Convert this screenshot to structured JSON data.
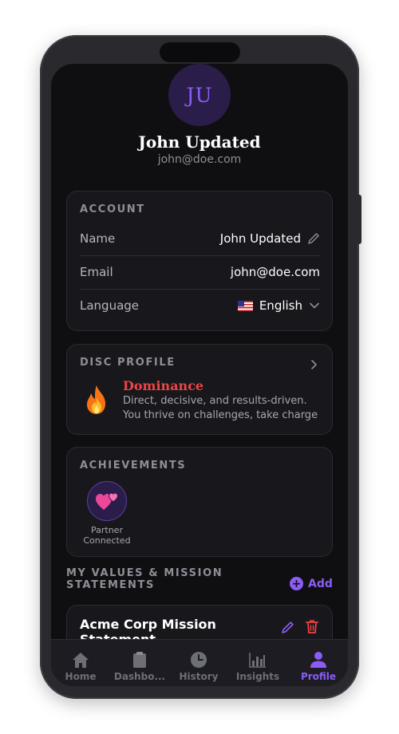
{
  "profile": {
    "initials": "JU",
    "name": "John Updated",
    "email": "john@doe.com"
  },
  "account": {
    "title": "ACCOUNT",
    "name_label": "Name",
    "name_value": "John Updated",
    "email_label": "Email",
    "email_value": "john@doe.com",
    "language_label": "Language",
    "language_value": "English"
  },
  "disc": {
    "title": "DISC PROFILE",
    "type": "Dominance",
    "description": "Direct, decisive, and results-driven. You thrive on challenges, take charge of ..."
  },
  "achievements": {
    "title": "ACHIEVEMENTS",
    "items": [
      {
        "label": "Partner Connected"
      }
    ]
  },
  "values": {
    "title": "MY VALUES & MISSION STATEMENTS",
    "add_label": "Add",
    "items": [
      {
        "title": "Acme Corp Mission Statement"
      }
    ]
  },
  "tabs": [
    {
      "label": "Home",
      "icon": "home-icon",
      "active": false
    },
    {
      "label": "Dashbo...",
      "icon": "clipboard-icon",
      "active": false
    },
    {
      "label": "History",
      "icon": "clock-icon",
      "active": false
    },
    {
      "label": "Insights",
      "icon": "chart-icon",
      "active": false
    },
    {
      "label": "Profile",
      "icon": "person-icon",
      "active": true
    }
  ],
  "colors": {
    "accent": "#8b5cf6",
    "danger": "#ef4444",
    "background": "#0f0f12",
    "card": "#18181c"
  }
}
